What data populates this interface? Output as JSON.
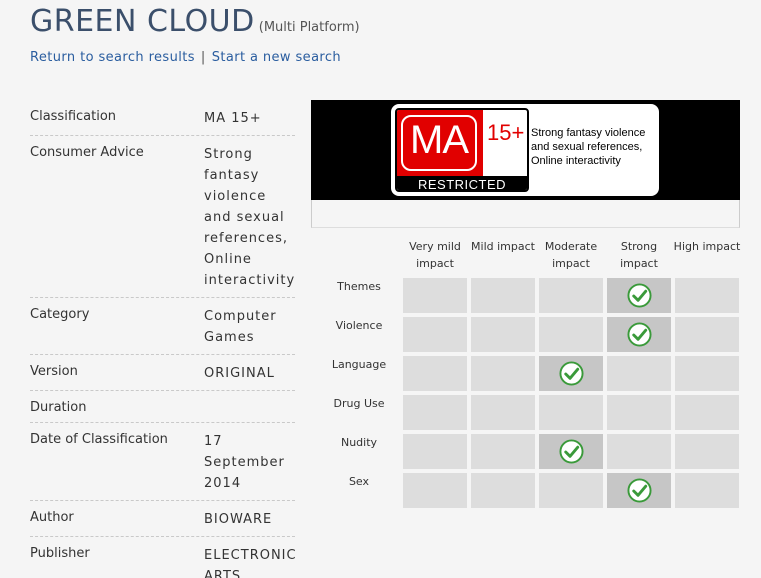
{
  "header": {
    "title": "GREEN CLOUD",
    "platform": "(Multi Platform)"
  },
  "links": {
    "return": "Return to search results",
    "separator": "|",
    "new_search": "Start a new search"
  },
  "details": [
    {
      "label": "Classification",
      "value": "MA 15+"
    },
    {
      "label": "Consumer Advice",
      "value": "Strong fantasy violence and sexual references, Online interactivity"
    },
    {
      "label": "Category",
      "value": "Computer Games"
    },
    {
      "label": "Version",
      "value": "ORIGINAL"
    },
    {
      "label": "Duration",
      "value": ""
    },
    {
      "label": "Date of Classification",
      "value": "17 September 2014"
    },
    {
      "label": "Author",
      "value": "BIOWARE"
    },
    {
      "label": "Publisher",
      "value": "ELECTRONIC ARTS"
    }
  ],
  "badge": {
    "rating": "MA",
    "age": "15+",
    "restricted": "RESTRICTED",
    "advice": "Strong fantasy violence and sexual references, Online interactivity",
    "colors": {
      "red": "#e10000",
      "black": "#000000"
    }
  },
  "impact": {
    "levels": [
      "Very mild impact",
      "Mild impact",
      "Moderate impact",
      "Strong impact",
      "High impact"
    ],
    "elements": [
      {
        "name": "Themes",
        "level": 3
      },
      {
        "name": "Violence",
        "level": 3
      },
      {
        "name": "Language",
        "level": 2
      },
      {
        "name": "Drug Use",
        "level": -1
      },
      {
        "name": "Nudity",
        "level": 2
      },
      {
        "name": "Sex",
        "level": 3
      }
    ],
    "check_icon": "check-circle-icon",
    "check_color": "#3a9a3a"
  },
  "colors": {
    "title": "#3b4f6b",
    "link": "#2a5d9f"
  }
}
